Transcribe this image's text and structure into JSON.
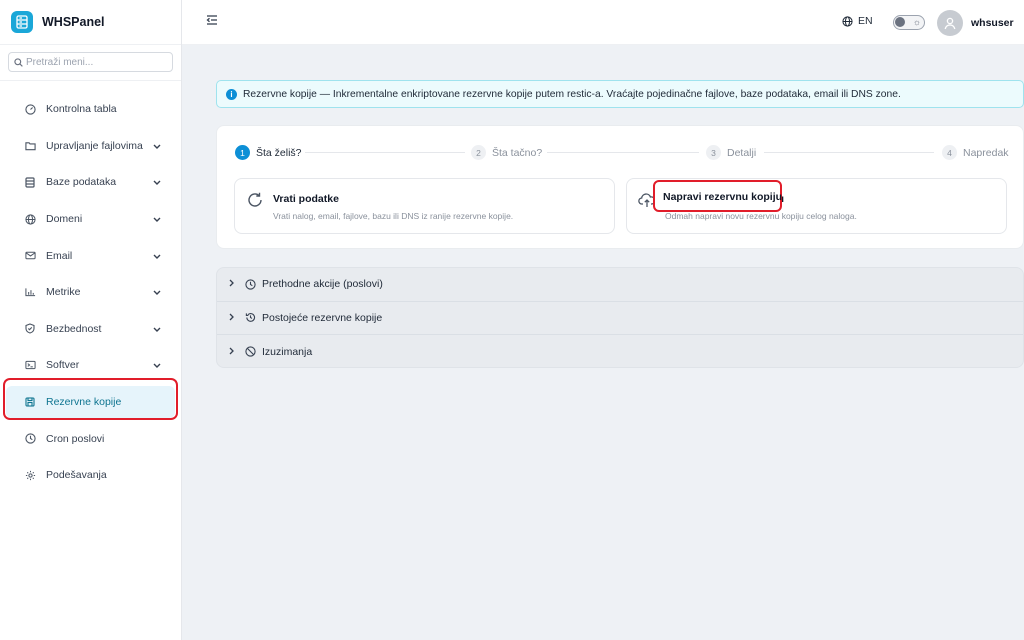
{
  "app": {
    "name": "WHSPanel",
    "accent": "#1aa7d8"
  },
  "search": {
    "placeholder": "Pretraži meni..."
  },
  "sidebar": {
    "items": [
      {
        "label": "Kontrolna tabla",
        "icon": "dashboard-icon",
        "has_children": false
      },
      {
        "label": "Upravljanje fajlovima",
        "icon": "folder-icon",
        "has_children": true
      },
      {
        "label": "Baze podataka",
        "icon": "database-icon",
        "has_children": true
      },
      {
        "label": "Domeni",
        "icon": "globe-icon",
        "has_children": true
      },
      {
        "label": "Email",
        "icon": "mail-icon",
        "has_children": true
      },
      {
        "label": "Metrike",
        "icon": "bar-chart-icon",
        "has_children": true
      },
      {
        "label": "Bezbednost",
        "icon": "shield-icon",
        "has_children": true
      },
      {
        "label": "Softver",
        "icon": "terminal-icon",
        "has_children": true
      },
      {
        "label": "Rezervne kopije",
        "icon": "save-icon",
        "has_children": false,
        "active": true
      },
      {
        "label": "Cron poslovi",
        "icon": "clock-icon",
        "has_children": false
      },
      {
        "label": "Podešavanja",
        "icon": "gear-icon",
        "has_children": false
      }
    ]
  },
  "topbar": {
    "language": "EN",
    "username": "whsuser",
    "theme": "light"
  },
  "alert": {
    "text": "Rezervne kopije — Inkrementalne enkriptovane rezervne kopije putem restic-a. Vraćajte pojedinačne fajlove, baze podataka, email ili DNS zone.",
    "color": "#0d8fd6"
  },
  "wizard": {
    "steps": [
      {
        "num": "1",
        "label": "Šta želiš?",
        "active": true
      },
      {
        "num": "2",
        "label": "Šta tačno?",
        "active": false
      },
      {
        "num": "3",
        "label": "Detalji",
        "active": false
      },
      {
        "num": "4",
        "label": "Napredak",
        "active": false
      }
    ],
    "options": [
      {
        "title": "Vrati podatke",
        "desc": "Vrati nalog, email, fajlove, bazu ili DNS iz ranije rezervne kopije.",
        "icon": "restore-icon"
      },
      {
        "title": "Napravi rezervnu kopiju",
        "desc": "Odmah napravi novu rezervnu kopiju celog naloga.",
        "icon": "cloud-upload-icon"
      }
    ]
  },
  "accordion": {
    "sections": [
      {
        "label": "Prethodne akcije (poslovi)",
        "icon": "clock-icon"
      },
      {
        "label": "Postojeće rezervne kopije",
        "icon": "history-icon"
      },
      {
        "label": "Izuzimanja",
        "icon": "ban-icon"
      }
    ]
  }
}
